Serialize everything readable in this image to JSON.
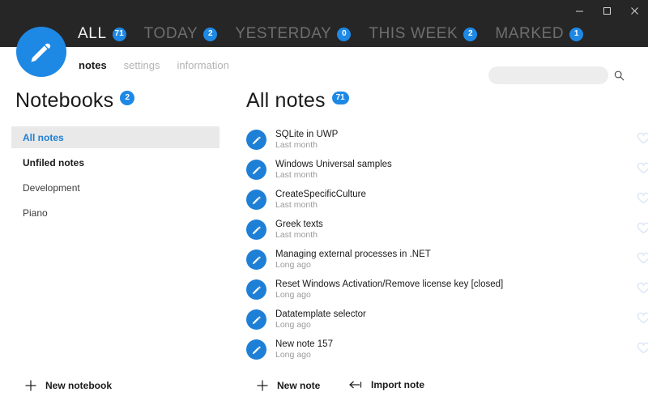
{
  "window": {
    "controls": [
      {
        "name": "minimize",
        "glyph": "minimize-icon"
      },
      {
        "name": "maximize",
        "glyph": "maximize-icon"
      },
      {
        "name": "close",
        "glyph": "close-icon"
      }
    ]
  },
  "colors": {
    "accent": "#1e88e5",
    "header_bg": "#262626",
    "selected_bg": "#e9e9e9",
    "selected_text": "#1e7fd6",
    "heart": "#dfe8f5"
  },
  "logo": {
    "icon": "pencil-icon"
  },
  "nav": {
    "filters": [
      {
        "label": "ALL",
        "count": "71",
        "active": true
      },
      {
        "label": "TODAY",
        "count": "2",
        "active": false
      },
      {
        "label": "YESTERDAY",
        "count": "0",
        "active": false
      },
      {
        "label": "THIS WEEK",
        "count": "2",
        "active": false
      },
      {
        "label": "MARKED",
        "count": "1",
        "active": false
      }
    ]
  },
  "tabs": [
    {
      "label": "notes",
      "active": true
    },
    {
      "label": "settings",
      "active": false
    },
    {
      "label": "information",
      "active": false
    }
  ],
  "search": {
    "value": "",
    "placeholder": "",
    "icon": "search-icon"
  },
  "sidebar": {
    "title": "Notebooks",
    "count": "2",
    "items": [
      {
        "label": "All notes",
        "state": "selected"
      },
      {
        "label": "Unfiled notes",
        "state": "strong"
      },
      {
        "label": "Development",
        "state": "normal"
      },
      {
        "label": "Piano",
        "state": "normal"
      }
    ]
  },
  "main": {
    "title": "All notes",
    "count": "71",
    "notes": [
      {
        "title": "SQLite in UWP",
        "subtitle": "Last month",
        "favorite": false
      },
      {
        "title": "Windows Universal samples",
        "subtitle": "Last month",
        "favorite": false
      },
      {
        "title": "CreateSpecificCulture",
        "subtitle": "Last month",
        "favorite": false
      },
      {
        "title": "Greek texts",
        "subtitle": "Last month",
        "favorite": false
      },
      {
        "title": "Managing external processes in .NET",
        "subtitle": "Long ago",
        "favorite": false
      },
      {
        "title": "Reset Windows Activation/Remove license key [closed]",
        "subtitle": "Long ago",
        "favorite": false
      },
      {
        "title": "Datatemplate selector",
        "subtitle": "Long ago",
        "favorite": false
      },
      {
        "title": "New note 157",
        "subtitle": "Long ago",
        "favorite": false
      }
    ]
  },
  "bottom": {
    "new_notebook": "New notebook",
    "new_note": "New note",
    "import_note": "Import note"
  }
}
